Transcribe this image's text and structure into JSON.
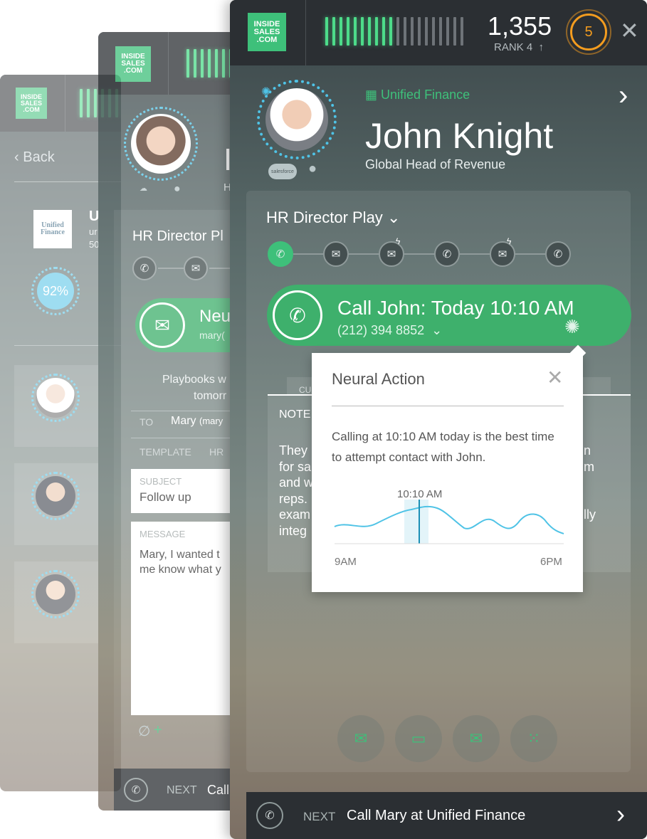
{
  "colors": {
    "accent": "#3ec07a",
    "topbar": "#2b2f33",
    "ring": "#4fc3e6",
    "badge": "#f39c1f"
  },
  "logo": {
    "line1": "INSIDE",
    "line2": "SALES",
    "line3": ".COM"
  },
  "back_panel": {
    "back_label": "Back",
    "company_initial": "U",
    "company_logo_text": "Unified Finance",
    "company_sub": "ur",
    "company_sub2": "50",
    "score": "92%"
  },
  "middle_panel": {
    "name_initial": "I",
    "subtitle_initial": "H",
    "play_title": "HR Director Pl",
    "email_title": "Neu",
    "email_sub": "mary(",
    "info_text_1": "Playbooks w",
    "info_text_2": "tomorr",
    "to_label": "TO",
    "to_value": "Mary",
    "to_value_small": "(mary",
    "template_label": "TEMPLATE",
    "template_value": "HR",
    "subject_label": "SUBJECT",
    "subject_value": "Follow up",
    "message_label": "MESSAGE",
    "message_line1": "Mary, I wanted t",
    "message_line2": "me know what y",
    "next_label": "NEXT",
    "next_value": "Call"
  },
  "front_panel": {
    "score": "1,355",
    "rank": "RANK 4",
    "rank_arrow": "↑",
    "badge": "5",
    "company": "Unified Finance",
    "contact_name": "John Knight",
    "contact_title": "Global Head of Revenue",
    "salesforce_label": "salesforce",
    "play_title": "HR Director Play",
    "call_title": "Call John: Today 10:10 AM",
    "call_phone": "(212) 394 8852",
    "note_label": "NOTE",
    "tab_fragment": "CU",
    "note_left": [
      "They",
      "for sa",
      "and w",
      "reps.",
      "exam",
      "integ"
    ],
    "note_right": [
      "n",
      "m",
      "",
      "",
      "lly",
      ""
    ],
    "next_label": "NEXT",
    "next_value": "Call Mary at Unified Finance"
  },
  "popup": {
    "title": "Neural Action",
    "body": "Calling at 10:10 AM today is the best time to attempt contact with John.",
    "marker_label": "10:10 AM",
    "axis_start": "9AM",
    "axis_end": "6PM"
  },
  "icons": {
    "phone": "✆",
    "mail": "✉",
    "chat": "▭",
    "grid": "⁙",
    "close": "✕",
    "chevron_right": "›",
    "chevron_down": "⌄",
    "building": "▦",
    "bulb": "●",
    "paperclip": "∅",
    "plus": "+"
  }
}
